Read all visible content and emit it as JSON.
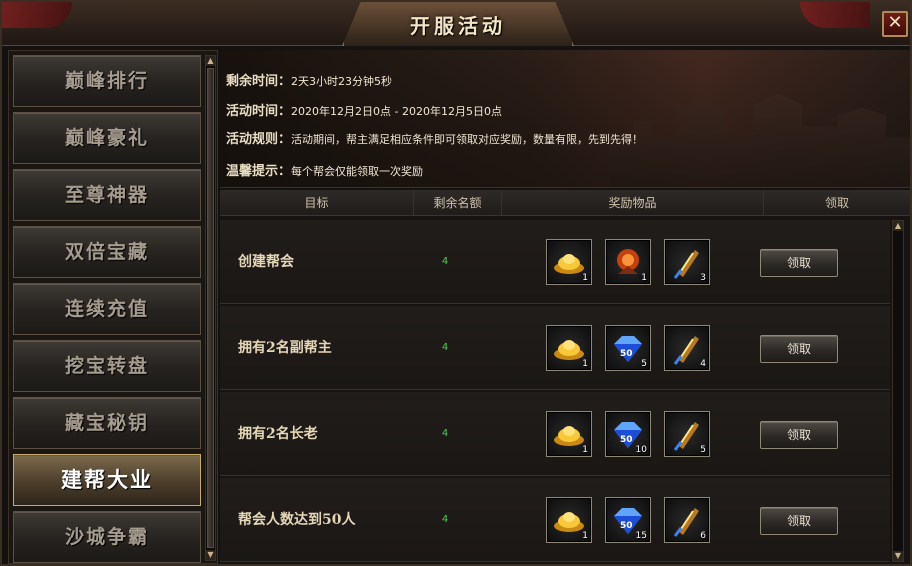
{
  "window": {
    "title": "开服活动",
    "close_symbol": "✕"
  },
  "sidebar": {
    "items": [
      {
        "label": "巅峰排行",
        "active": false
      },
      {
        "label": "巅峰豪礼",
        "active": false
      },
      {
        "label": "至尊神器",
        "active": false
      },
      {
        "label": "双倍宝藏",
        "active": false
      },
      {
        "label": "连续充值",
        "active": false
      },
      {
        "label": "挖宝转盘",
        "active": false
      },
      {
        "label": "藏宝秘钥",
        "active": false
      },
      {
        "label": "建帮大业",
        "active": true
      },
      {
        "label": "沙城争霸",
        "active": false
      }
    ]
  },
  "info": {
    "remaining_label": "剩余时间：",
    "remaining_value": "2天3小时23分钟5秒",
    "period_label": "活动时间：",
    "period_value": "2020年12月2日0点 - 2020年12月5日0点",
    "rules_label": "活动规则：",
    "rules_value": "活动期间，帮主满足相应条件即可领取对应奖励，数量有限，先到先得！",
    "tip_label": "温馨提示：",
    "tip_value": "每个帮会仅能领取一次奖励"
  },
  "table": {
    "headers": {
      "goal": "目标",
      "remaining": "剩余名额",
      "rewards": "奖励物品",
      "claim": "领取"
    },
    "rows": [
      {
        "goal": "创建帮会",
        "remaining": "4",
        "rewards": [
          {
            "icon": "gold-ingot-icon",
            "count": "1"
          },
          {
            "icon": "orange-orb-icon",
            "count": "1"
          },
          {
            "icon": "scroll-icon",
            "count": "3"
          }
        ],
        "claim_label": "领取"
      },
      {
        "goal": "拥有2名副帮主",
        "remaining": "4",
        "rewards": [
          {
            "icon": "gold-ingot-icon",
            "count": "1"
          },
          {
            "icon": "diamond-icon",
            "count": "5",
            "badge": "50"
          },
          {
            "icon": "scroll-icon",
            "count": "4"
          }
        ],
        "claim_label": "领取"
      },
      {
        "goal": "拥有2名长老",
        "remaining": "4",
        "rewards": [
          {
            "icon": "gold-ingot-icon",
            "count": "1"
          },
          {
            "icon": "diamond-icon",
            "count": "10",
            "badge": "50"
          },
          {
            "icon": "scroll-icon",
            "count": "5"
          }
        ],
        "claim_label": "领取"
      },
      {
        "goal": "帮会人数达到50人",
        "remaining": "4",
        "rewards": [
          {
            "icon": "gold-ingot-icon",
            "count": "1"
          },
          {
            "icon": "diamond-icon",
            "count": "15",
            "badge": "50"
          },
          {
            "icon": "scroll-icon",
            "count": "6"
          }
        ],
        "claim_label": "领取"
      }
    ]
  },
  "colors": {
    "remaining_green": "#46d24a",
    "active_gold": "#c6a96f"
  }
}
